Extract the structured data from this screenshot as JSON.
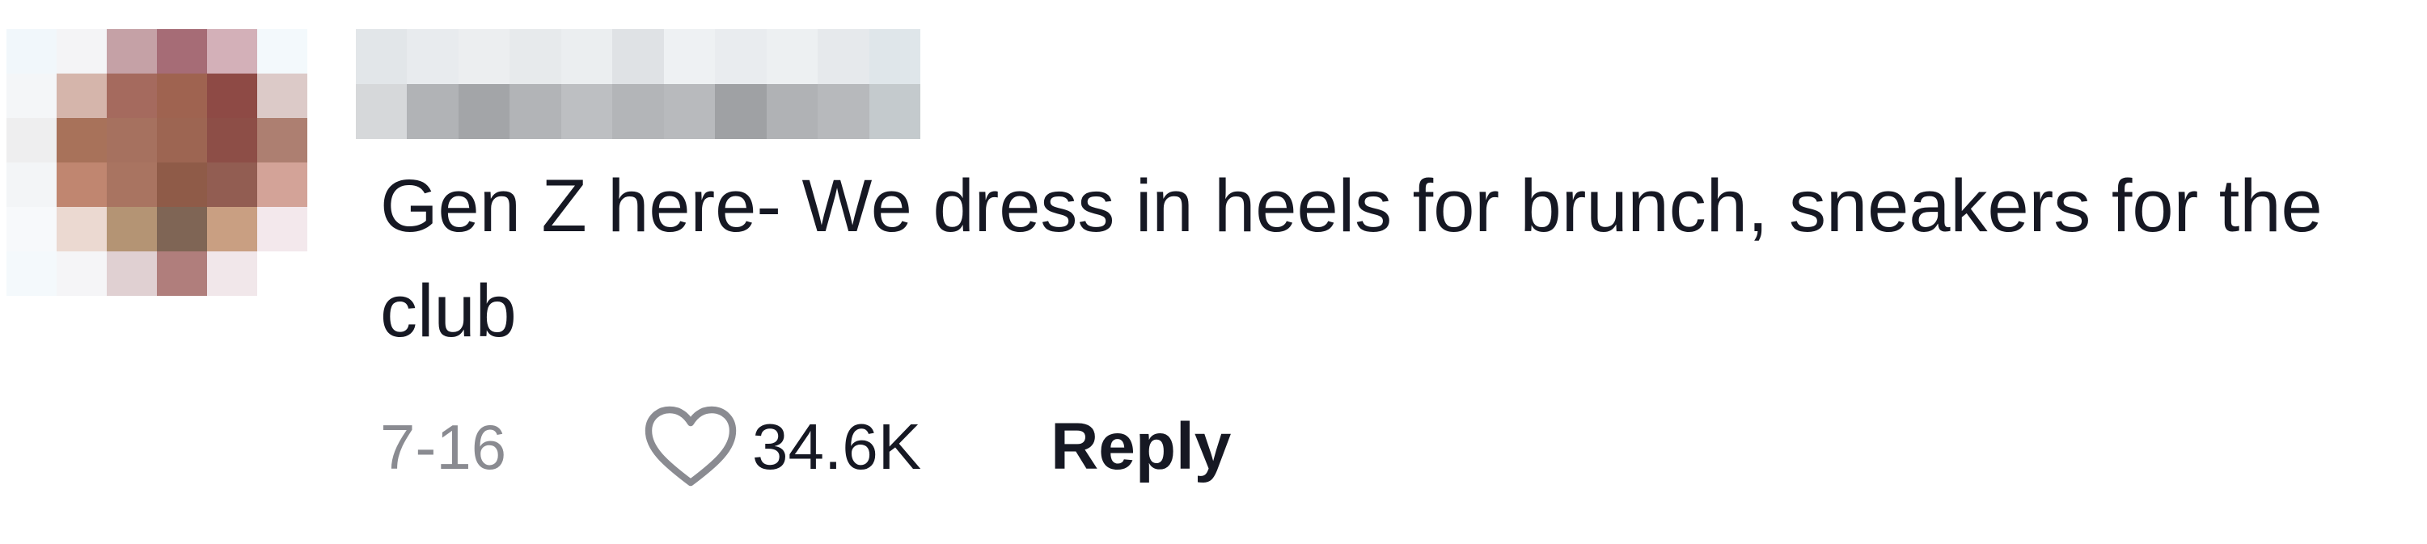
{
  "comment": {
    "text": "Gen Z here- We dress in heels for brunch, sneakers for the club",
    "date": "7-16",
    "like_count": "34.6K",
    "reply_label": "Reply",
    "like_icon": "heart-outline-icon",
    "avatar_blurred": true,
    "username_blurred": true
  }
}
